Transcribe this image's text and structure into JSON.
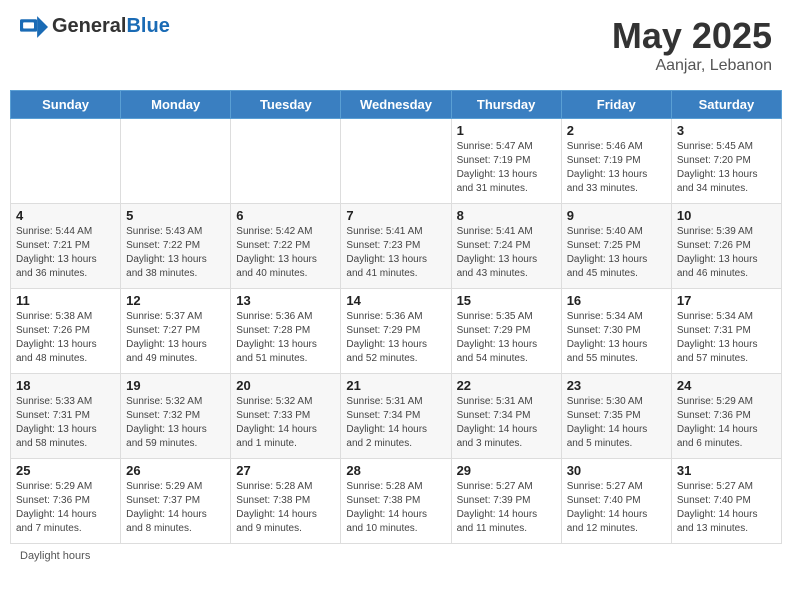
{
  "header": {
    "logo_general": "General",
    "logo_blue": "Blue",
    "month_year": "May 2025",
    "location": "Aanjar, Lebanon"
  },
  "footer": {
    "note": "Daylight hours"
  },
  "days_of_week": [
    "Sunday",
    "Monday",
    "Tuesday",
    "Wednesday",
    "Thursday",
    "Friday",
    "Saturday"
  ],
  "weeks": [
    [
      {
        "day": "",
        "info": ""
      },
      {
        "day": "",
        "info": ""
      },
      {
        "day": "",
        "info": ""
      },
      {
        "day": "",
        "info": ""
      },
      {
        "day": "1",
        "info": "Sunrise: 5:47 AM\nSunset: 7:19 PM\nDaylight: 13 hours\nand 31 minutes."
      },
      {
        "day": "2",
        "info": "Sunrise: 5:46 AM\nSunset: 7:19 PM\nDaylight: 13 hours\nand 33 minutes."
      },
      {
        "day": "3",
        "info": "Sunrise: 5:45 AM\nSunset: 7:20 PM\nDaylight: 13 hours\nand 34 minutes."
      }
    ],
    [
      {
        "day": "4",
        "info": "Sunrise: 5:44 AM\nSunset: 7:21 PM\nDaylight: 13 hours\nand 36 minutes."
      },
      {
        "day": "5",
        "info": "Sunrise: 5:43 AM\nSunset: 7:22 PM\nDaylight: 13 hours\nand 38 minutes."
      },
      {
        "day": "6",
        "info": "Sunrise: 5:42 AM\nSunset: 7:22 PM\nDaylight: 13 hours\nand 40 minutes."
      },
      {
        "day": "7",
        "info": "Sunrise: 5:41 AM\nSunset: 7:23 PM\nDaylight: 13 hours\nand 41 minutes."
      },
      {
        "day": "8",
        "info": "Sunrise: 5:41 AM\nSunset: 7:24 PM\nDaylight: 13 hours\nand 43 minutes."
      },
      {
        "day": "9",
        "info": "Sunrise: 5:40 AM\nSunset: 7:25 PM\nDaylight: 13 hours\nand 45 minutes."
      },
      {
        "day": "10",
        "info": "Sunrise: 5:39 AM\nSunset: 7:26 PM\nDaylight: 13 hours\nand 46 minutes."
      }
    ],
    [
      {
        "day": "11",
        "info": "Sunrise: 5:38 AM\nSunset: 7:26 PM\nDaylight: 13 hours\nand 48 minutes."
      },
      {
        "day": "12",
        "info": "Sunrise: 5:37 AM\nSunset: 7:27 PM\nDaylight: 13 hours\nand 49 minutes."
      },
      {
        "day": "13",
        "info": "Sunrise: 5:36 AM\nSunset: 7:28 PM\nDaylight: 13 hours\nand 51 minutes."
      },
      {
        "day": "14",
        "info": "Sunrise: 5:36 AM\nSunset: 7:29 PM\nDaylight: 13 hours\nand 52 minutes."
      },
      {
        "day": "15",
        "info": "Sunrise: 5:35 AM\nSunset: 7:29 PM\nDaylight: 13 hours\nand 54 minutes."
      },
      {
        "day": "16",
        "info": "Sunrise: 5:34 AM\nSunset: 7:30 PM\nDaylight: 13 hours\nand 55 minutes."
      },
      {
        "day": "17",
        "info": "Sunrise: 5:34 AM\nSunset: 7:31 PM\nDaylight: 13 hours\nand 57 minutes."
      }
    ],
    [
      {
        "day": "18",
        "info": "Sunrise: 5:33 AM\nSunset: 7:31 PM\nDaylight: 13 hours\nand 58 minutes."
      },
      {
        "day": "19",
        "info": "Sunrise: 5:32 AM\nSunset: 7:32 PM\nDaylight: 13 hours\nand 59 minutes."
      },
      {
        "day": "20",
        "info": "Sunrise: 5:32 AM\nSunset: 7:33 PM\nDaylight: 14 hours\nand 1 minute."
      },
      {
        "day": "21",
        "info": "Sunrise: 5:31 AM\nSunset: 7:34 PM\nDaylight: 14 hours\nand 2 minutes."
      },
      {
        "day": "22",
        "info": "Sunrise: 5:31 AM\nSunset: 7:34 PM\nDaylight: 14 hours\nand 3 minutes."
      },
      {
        "day": "23",
        "info": "Sunrise: 5:30 AM\nSunset: 7:35 PM\nDaylight: 14 hours\nand 5 minutes."
      },
      {
        "day": "24",
        "info": "Sunrise: 5:29 AM\nSunset: 7:36 PM\nDaylight: 14 hours\nand 6 minutes."
      }
    ],
    [
      {
        "day": "25",
        "info": "Sunrise: 5:29 AM\nSunset: 7:36 PM\nDaylight: 14 hours\nand 7 minutes."
      },
      {
        "day": "26",
        "info": "Sunrise: 5:29 AM\nSunset: 7:37 PM\nDaylight: 14 hours\nand 8 minutes."
      },
      {
        "day": "27",
        "info": "Sunrise: 5:28 AM\nSunset: 7:38 PM\nDaylight: 14 hours\nand 9 minutes."
      },
      {
        "day": "28",
        "info": "Sunrise: 5:28 AM\nSunset: 7:38 PM\nDaylight: 14 hours\nand 10 minutes."
      },
      {
        "day": "29",
        "info": "Sunrise: 5:27 AM\nSunset: 7:39 PM\nDaylight: 14 hours\nand 11 minutes."
      },
      {
        "day": "30",
        "info": "Sunrise: 5:27 AM\nSunset: 7:40 PM\nDaylight: 14 hours\nand 12 minutes."
      },
      {
        "day": "31",
        "info": "Sunrise: 5:27 AM\nSunset: 7:40 PM\nDaylight: 14 hours\nand 13 minutes."
      }
    ]
  ]
}
